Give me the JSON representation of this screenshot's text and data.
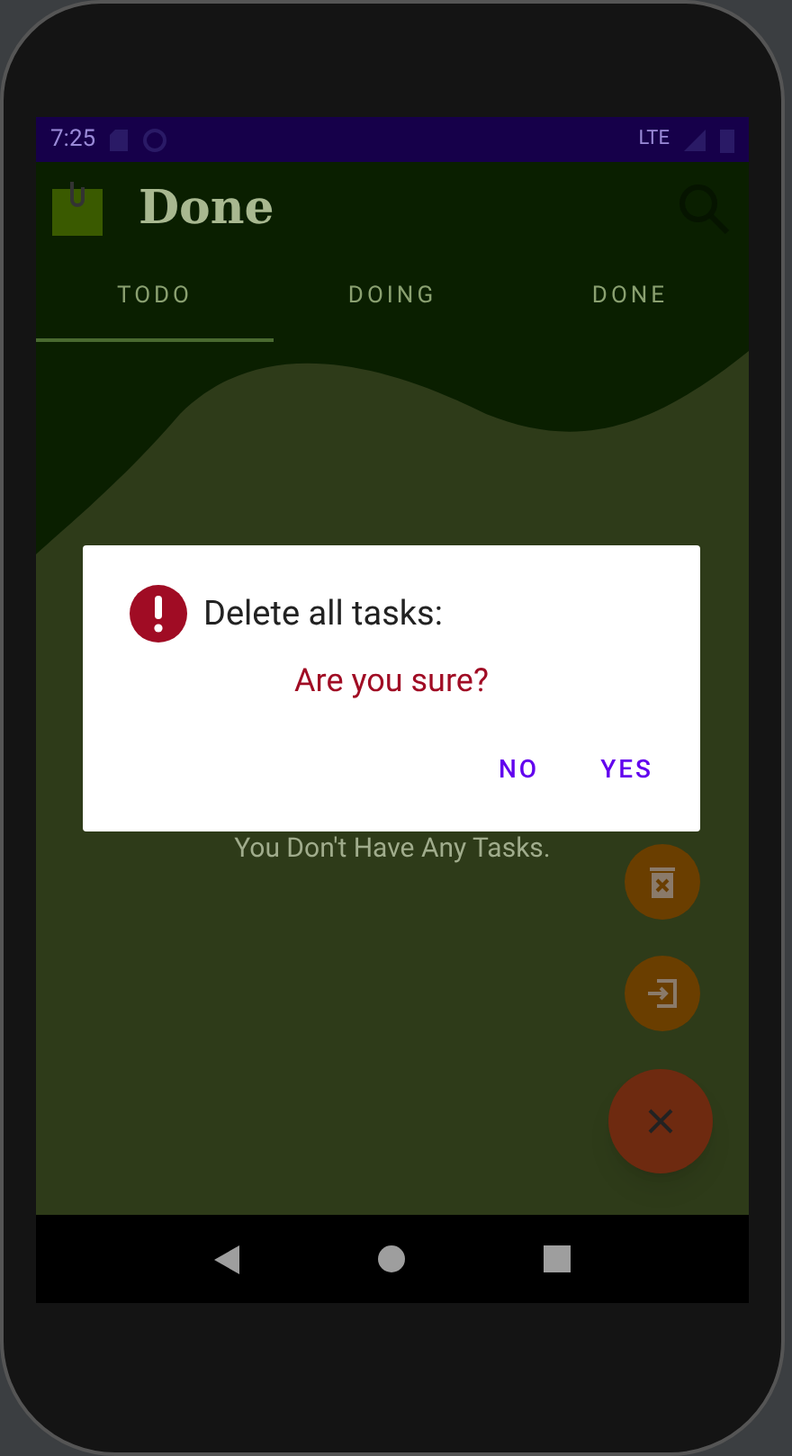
{
  "status_bar": {
    "time": "7:25",
    "network": "LTE"
  },
  "app_bar": {
    "title": "Done"
  },
  "tabs": [
    {
      "label": "TODO",
      "selected": true
    },
    {
      "label": "DOING",
      "selected": false
    },
    {
      "label": "DONE",
      "selected": false
    }
  ],
  "empty_message": "You Don't Have Any Tasks.",
  "dialog": {
    "title": "Delete all tasks:",
    "message": "Are you sure?",
    "buttons": [
      "NO",
      "YES"
    ]
  },
  "fab_menu": {
    "expanded": true
  }
}
